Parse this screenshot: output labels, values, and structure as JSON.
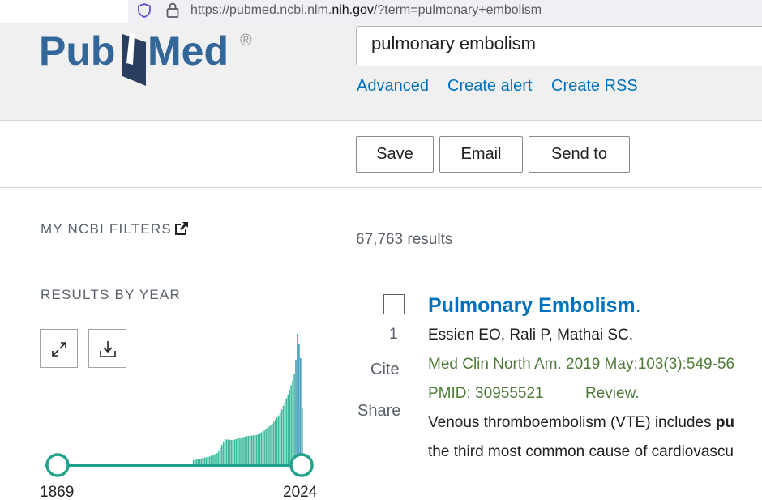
{
  "browser": {
    "url_prefix": "https://pubmed.ncbi.nlm.",
    "url_domain": "nih.gov",
    "url_suffix": "/?term=pulmonary+embolism"
  },
  "header": {
    "logo_text_pub": "Pub",
    "logo_text_med": "Med",
    "logo_registered": "®",
    "search_value": "pulmonary embolism",
    "links": [
      "Advanced",
      "Create alert",
      "Create RSS"
    ]
  },
  "toolbar": {
    "save_label": "Save",
    "email_label": "Email",
    "send_to_label": "Send to"
  },
  "sidebar": {
    "filters_title": "MY NCBI FILTERS",
    "results_by_year_title": "RESULTS BY YEAR",
    "expand_icon": "expand-icon",
    "download_icon": "download-icon",
    "year_start": "1869",
    "year_end": "2024"
  },
  "results": {
    "count_text": "67,763 results",
    "items": [
      {
        "number": "1",
        "title": "Pulmonary Embolism",
        "title_suffix": ".",
        "cite_label": "Cite",
        "share_label": "Share",
        "authors": "Essien EO, Rali P, Mathai SC.",
        "citation": "Med Clin North Am. 2019 May;103(3):549-56",
        "pmid": "PMID: 30955521",
        "pub_type": "Review.",
        "snippet_line1_pre": "Venous thromboembolism (VTE) includes ",
        "snippet_line1_bold": "pu",
        "snippet_line2": "the third most common cause of cardiovascu"
      }
    ]
  },
  "colors": {
    "link_blue": "#0071bc",
    "citation_green": "#4f7a3a",
    "bar_teal": "#3cb89b",
    "bar_recent": "#3a9ab8",
    "slider": "#20a28b",
    "logo_blue": "#336699"
  },
  "chart_data": {
    "type": "bar",
    "x_range": [
      1869,
      2024
    ],
    "values_note_free": true,
    "years": [
      1955,
      1960,
      1965,
      1970,
      1975,
      1980,
      1985,
      1990,
      1995,
      2000,
      2005,
      2010,
      2015,
      2018,
      2019,
      2020,
      2021,
      2022,
      2023,
      2024
    ],
    "values": [
      200,
      300,
      400,
      600,
      1400,
      1350,
      1500,
      1600,
      1650,
      1900,
      2300,
      2900,
      4000,
      4800,
      5200,
      6000,
      7500,
      6900,
      6100,
      3200
    ],
    "slider_handles": [
      1869,
      2024
    ]
  }
}
